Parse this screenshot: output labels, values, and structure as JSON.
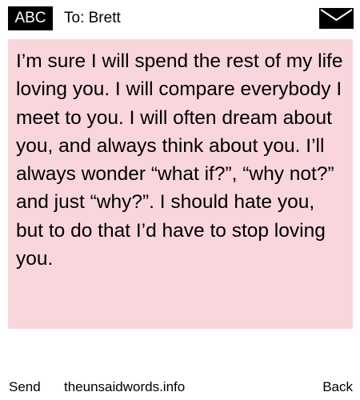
{
  "header": {
    "badge_label": "ABC",
    "recipient": "To: Brett",
    "mail_icon": "envelope-icon"
  },
  "message": {
    "body": "I’m sure I will spend the rest of my life loving you. I will compare everybody I meet to you. I will often dream about you, and always think about you. I’ll always wonder “what if?”, “why not?” and just “why?”. I should hate you, but to do that I’d have to stop loving you."
  },
  "footer": {
    "send_label": "Send",
    "site_label": "theunsaidwords.info",
    "back_label": "Back"
  },
  "colors": {
    "message_background": "#f9d6dc",
    "badge_background": "#000000",
    "badge_text": "#ffffff"
  }
}
